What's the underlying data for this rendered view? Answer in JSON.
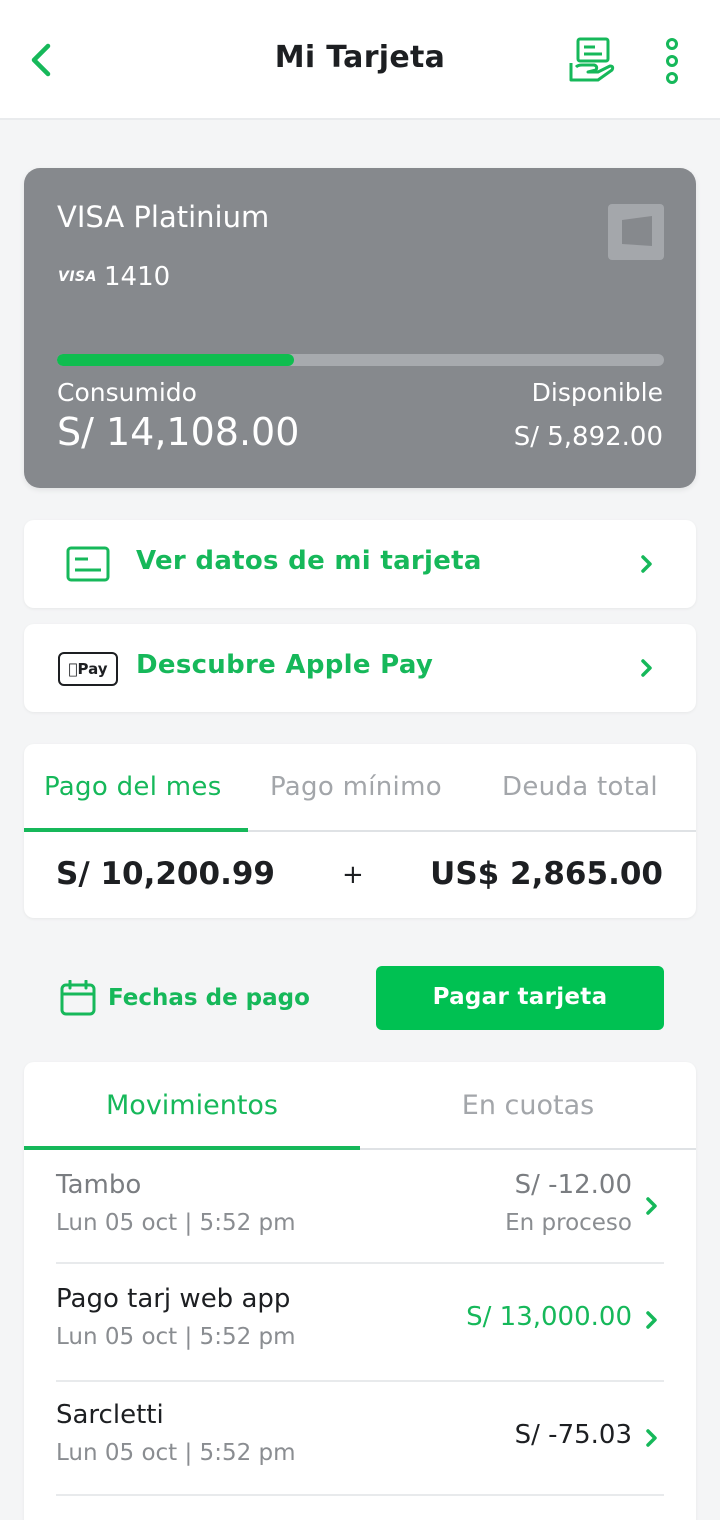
{
  "header": {
    "title": "Mi Tarjeta",
    "back_icon": "chevron-left-icon",
    "hand_card_icon": "card-in-hand-icon",
    "more_icon": "vertical-dots-icon"
  },
  "card": {
    "name": "VISA Platinium",
    "brand": "VISA",
    "last4": "1410",
    "consumed_label": "Consumido",
    "consumed_value": "S/ 14,108.00",
    "available_label": "Disponible",
    "available_value": "S/ 5,892.00",
    "usage_fraction": 0.39
  },
  "actions": [
    {
      "label": "Ver datos de mi tarjeta",
      "icon": "card-details-icon"
    },
    {
      "label": "Descubre Apple Pay",
      "icon": "apple-pay-icon",
      "badge": "Pay"
    }
  ],
  "payment": {
    "tabs": [
      "Pago del mes",
      "Pago mínimo",
      "Deuda total"
    ],
    "active_tab": 0,
    "amount_pen": "S/ 10,200.99",
    "plus": "+",
    "amount_usd": "US$ 2,865.00"
  },
  "dates_link": {
    "label": "Fechas de pago",
    "icon": "calendar-icon"
  },
  "pay_button": {
    "label": "Pagar tarjeta"
  },
  "movements": {
    "tabs": [
      "Movimientos",
      "En cuotas"
    ],
    "active_tab": 0,
    "items": [
      {
        "name": "Tambo",
        "date": "Lun 05 oct | 5:52 pm",
        "amount": "S/ -12.00",
        "status": "En proceso"
      },
      {
        "name": "Pago tarj web app",
        "date": "Lun 05 oct | 5:52 pm",
        "amount": "S/ 13,000.00",
        "status": ""
      },
      {
        "name": "Sarcletti",
        "date": "Lun 05 oct | 5:52 pm",
        "amount": "S/ -75.03",
        "status": ""
      }
    ]
  },
  "colors": {
    "accent_green": "#16b85a",
    "button_green": "#00c152",
    "card_gray": "#86898d"
  }
}
